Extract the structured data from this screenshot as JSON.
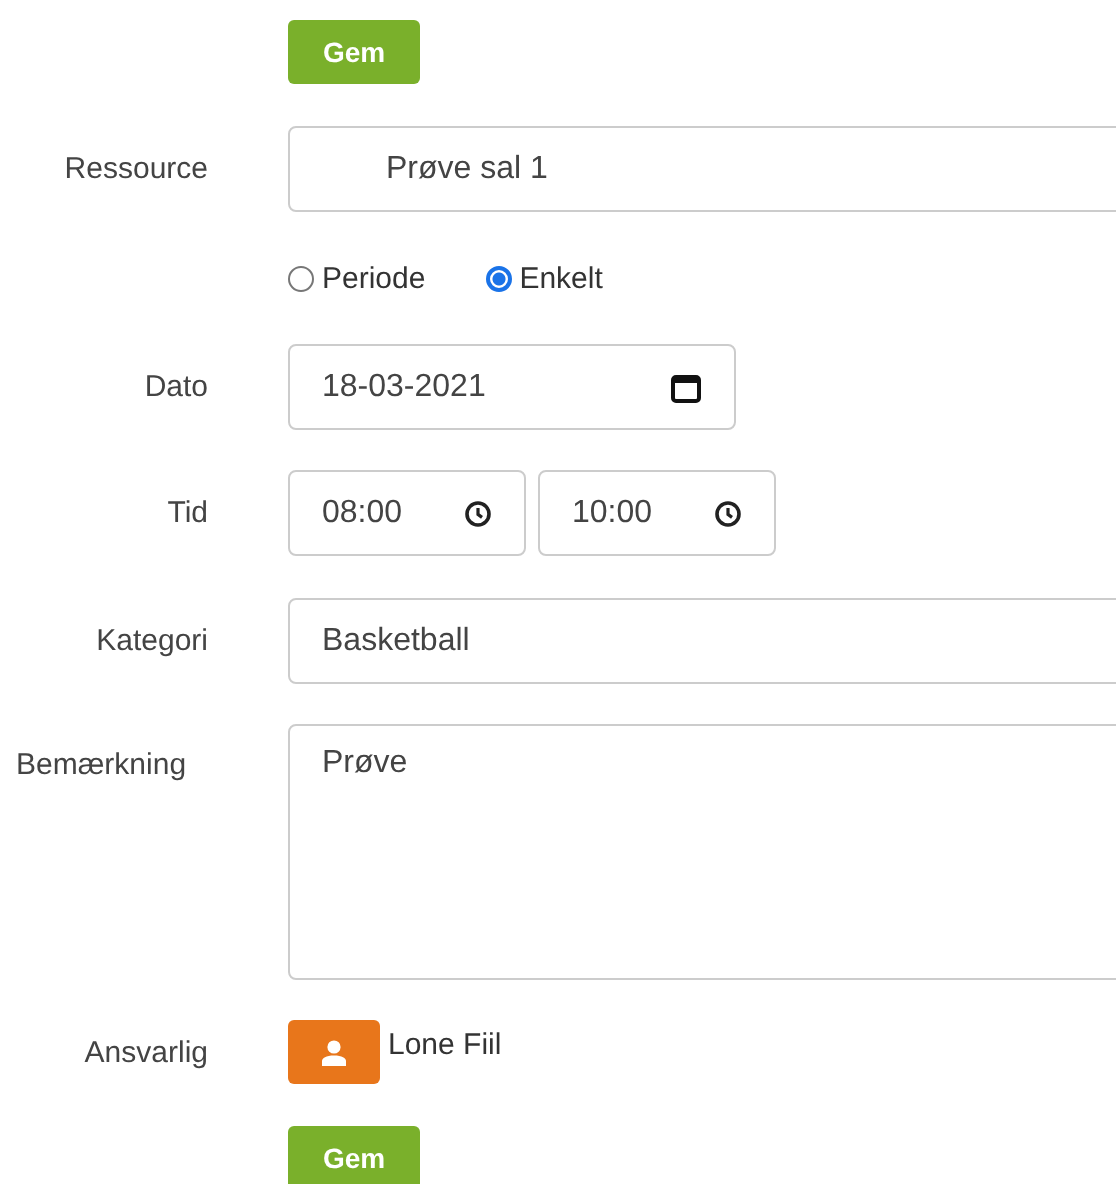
{
  "top_button": "Gem",
  "resource": {
    "label": "Ressource",
    "value": "Prøve sal 1"
  },
  "mode": [
    {
      "label": "Periode",
      "selected": false
    },
    {
      "label": "Enkelt",
      "selected": true
    }
  ],
  "date": {
    "label": "Dato",
    "value": "18-03-2021"
  },
  "time": {
    "label": "Tid",
    "from": "08:00",
    "to": "10:00"
  },
  "category": {
    "label": "Kategori",
    "value": "Basketball"
  },
  "note": {
    "label": "Bemærkning",
    "value": "Prøve"
  },
  "responsible": {
    "label": "Ansvarlig",
    "name": "Lone Fiil"
  },
  "bottom_button": "Gem"
}
